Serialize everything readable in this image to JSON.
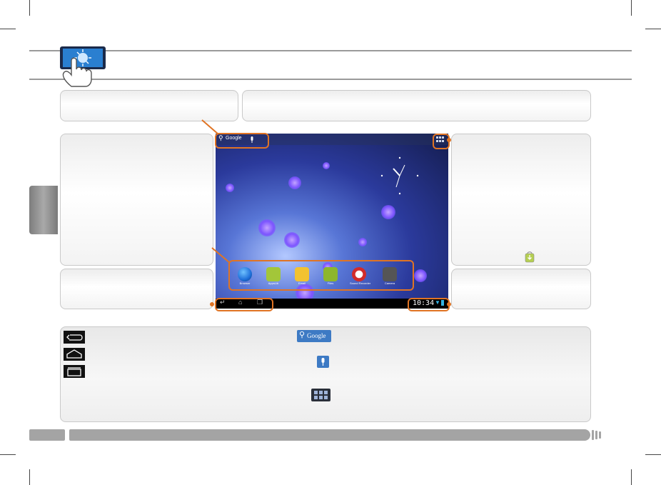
{
  "screenshot": {
    "search_label": "Google",
    "apps": [
      {
        "label": "Browser",
        "color": "#1e6fd9"
      },
      {
        "label": "AppsLib",
        "color": "#a3c639"
      },
      {
        "label": "Email",
        "color": "#f2c230"
      },
      {
        "label": "Files",
        "color": "#8db62c"
      },
      {
        "label": "Sound Recorder",
        "color": "#d12b2b"
      },
      {
        "label": "Camera",
        "color": "#555555"
      }
    ],
    "time": "10:34"
  },
  "legend": {
    "search_label": "Google"
  },
  "colors": {
    "accent": "#e07424",
    "panel_border": "#c9c9c9",
    "footer": "#a4a4a4"
  }
}
